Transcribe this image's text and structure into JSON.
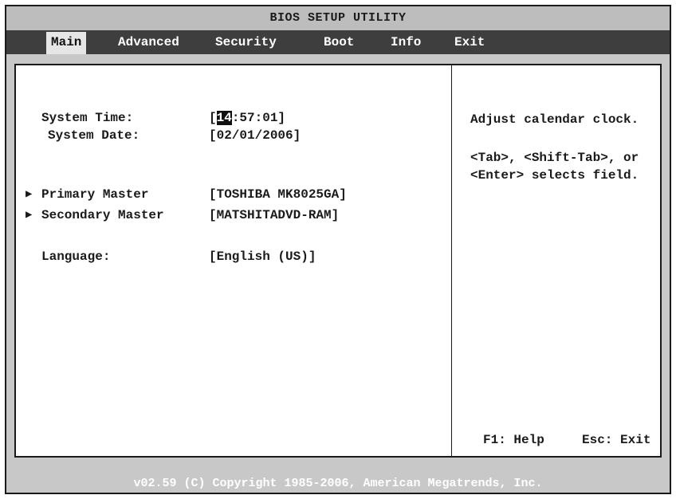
{
  "title": "BIOS SETUP UTILITY",
  "menu": {
    "tabs": [
      {
        "label": "Main",
        "active": true
      },
      {
        "label": "Advanced",
        "active": false
      },
      {
        "label": "Security",
        "active": false
      },
      {
        "label": "Boot",
        "active": false
      },
      {
        "label": "Info",
        "active": false
      },
      {
        "label": "Exit",
        "active": false
      }
    ]
  },
  "main": {
    "system_time": {
      "label": "System Time:",
      "open": "[",
      "selected_field": "14",
      "rest": ":57:01]"
    },
    "system_date": {
      "label": "System Date:",
      "value": "[02/01/2006]"
    },
    "primary_master": {
      "label": "Primary Master",
      "value": "[TOSHIBA MK8025GA]"
    },
    "secondary_master": {
      "label": "Secondary Master",
      "value": "[MATSHITADVD-RAM]"
    },
    "language": {
      "label": "Language:",
      "value": "[English (US)]"
    }
  },
  "help": {
    "line1": "Adjust calendar clock.",
    "line2": "<Tab>, <Shift-Tab>, or",
    "line3": "<Enter> selects field.",
    "f1": "F1: Help",
    "esc": "Esc: Exit"
  },
  "footer": {
    "text": "v02.59 (C) Copyright 1985-2006, American Megatrends, Inc."
  },
  "icons": {
    "submenu_arrow": "triangle-right-icon"
  }
}
